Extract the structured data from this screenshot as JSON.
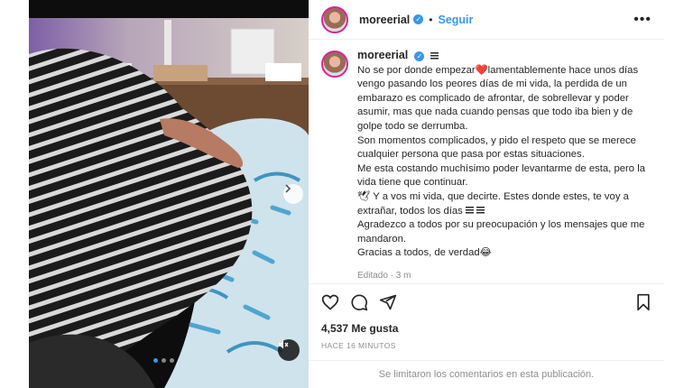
{
  "post": {
    "username": "moreerial",
    "follow_label": "Seguir",
    "caption_lines": [
      "No se por donde empezar❤️lamentablemente hace unos días vengo pasando los peores días de mi vida, la perdida de un embarazo es complicado de afrontar, de sobrellevar y poder asumir, mas que nada cuando pensas que todo iba bien y de golpe todo se derrumba.",
      "Son momentos complicados, y pido el respeto que se merece cualquier persona que pasa por estas situaciones.",
      "Me esta costando muchísimo poder levantarme de esta, pero la vida tiene que continuar.",
      "🕊 Y a vos mi vida, que decirte. Estes donde estes, te voy a extrañar, todos los días",
      "Agradezco a todos por su preocupación y los mensajes que me mandaron.",
      "Gracias a todos, de verdad😂"
    ],
    "edited_label": "Editado · 3 m",
    "likes": "4,537 Me gusta",
    "time_ago": "HACE 16 MINUTOS",
    "comments_disabled": "Se limitaron los comentarios en esta publicación."
  },
  "icons": {
    "verified": "verified-badge-icon",
    "more": "more-options-icon",
    "like": "heart-icon",
    "comment": "comment-icon",
    "share": "share-icon",
    "save": "bookmark-icon",
    "next": "chevron-right-icon",
    "mute": "muted-speaker-icon"
  },
  "colors": {
    "link_blue": "#3897f0",
    "text": "#262626",
    "muted": "#8e8e8e",
    "divider": "#efefef"
  },
  "carousel": {
    "count": 3,
    "active_index": 0
  }
}
